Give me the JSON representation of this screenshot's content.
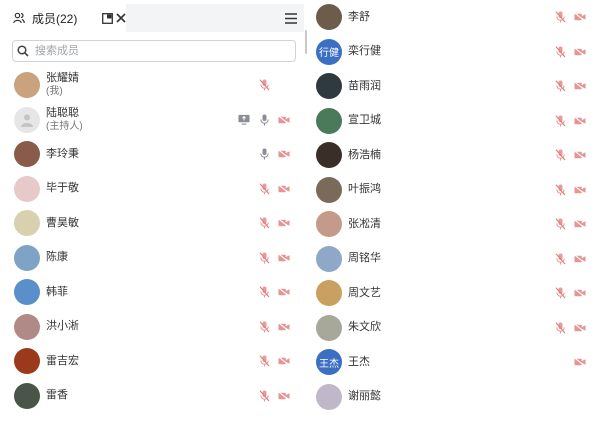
{
  "header": {
    "title": "成员(22)"
  },
  "search": {
    "placeholder": "搜索成员"
  },
  "left_members": [
    {
      "name": "张耀婧",
      "role": "(我)",
      "avatar_color": "#c9a27e",
      "share": false,
      "mic": "muted",
      "cam": false
    },
    {
      "name": "陆聪聪",
      "role": "(主持人)",
      "avatar_color": "#e6e6e6",
      "share": true,
      "mic": "on",
      "cam": true
    },
    {
      "name": "李玲秉",
      "role": "",
      "avatar_color": "#8a5a4a",
      "share": false,
      "mic": "on",
      "cam": true
    },
    {
      "name": "毕于敬",
      "role": "",
      "avatar_color": "#e8c9c9",
      "share": false,
      "mic": "muted",
      "cam": true
    },
    {
      "name": "曹昊敏",
      "role": "",
      "avatar_color": "#d9d0b0",
      "share": false,
      "mic": "muted",
      "cam": true
    },
    {
      "name": "陈康",
      "role": "",
      "avatar_color": "#7fa3c4",
      "share": false,
      "mic": "muted",
      "cam": true
    },
    {
      "name": "韩菲",
      "role": "",
      "avatar_color": "#5b8fc9",
      "share": false,
      "mic": "muted",
      "cam": true
    },
    {
      "name": "洪小淅",
      "role": "",
      "avatar_color": "#b08a86",
      "share": false,
      "mic": "muted",
      "cam": true
    },
    {
      "name": "雷吉宏",
      "role": "",
      "avatar_color": "#9a3a1a",
      "share": false,
      "mic": "muted",
      "cam": true
    },
    {
      "name": "雷香",
      "role": "",
      "avatar_color": "#4a5548",
      "share": false,
      "mic": "muted",
      "cam": true
    }
  ],
  "right_members": [
    {
      "name": "李舒",
      "avatar_text": "",
      "avatar_color": "#6b5c4c",
      "mic": "muted",
      "cam": true
    },
    {
      "name": "栾行健",
      "avatar_text": "行健",
      "avatar_color": "#3a6fc1",
      "mic": "muted",
      "cam": true
    },
    {
      "name": "苗雨润",
      "avatar_text": "",
      "avatar_color": "#2e3a40",
      "mic": "muted",
      "cam": true
    },
    {
      "name": "宣卫城",
      "avatar_text": "",
      "avatar_color": "#4a7a5a",
      "mic": "muted",
      "cam": true
    },
    {
      "name": "杨浩楠",
      "avatar_text": "",
      "avatar_color": "#3a2e28",
      "mic": "muted",
      "cam": true
    },
    {
      "name": "叶振鸿",
      "avatar_text": "",
      "avatar_color": "#7a6a5a",
      "mic": "muted",
      "cam": true
    },
    {
      "name": "张凇清",
      "avatar_text": "",
      "avatar_color": "#c49a8a",
      "mic": "muted",
      "cam": true
    },
    {
      "name": "周铭华",
      "avatar_text": "",
      "avatar_color": "#8fa8c8",
      "mic": "muted",
      "cam": true
    },
    {
      "name": "周文艺",
      "avatar_text": "",
      "avatar_color": "#c9a060",
      "mic": "muted",
      "cam": true
    },
    {
      "name": "朱文欣",
      "avatar_text": "",
      "avatar_color": "#a8a89a",
      "mic": "muted",
      "cam": true
    },
    {
      "name": "王杰",
      "avatar_text": "王杰",
      "avatar_color": "#3a6fc1",
      "mic": "none",
      "cam": true
    },
    {
      "name": "谢丽懿",
      "avatar_text": "",
      "avatar_color": "#c0b8c8",
      "mic": "none",
      "cam": false
    }
  ],
  "icons": {
    "members": "people-icon",
    "popout": "popout-icon",
    "close": "close-icon",
    "menu": "menu-icon",
    "search": "search-icon",
    "share": "screen-share-icon",
    "mic_on": "mic-icon",
    "mic_muted": "mic-muted-icon",
    "cam_off": "camera-off-icon"
  }
}
